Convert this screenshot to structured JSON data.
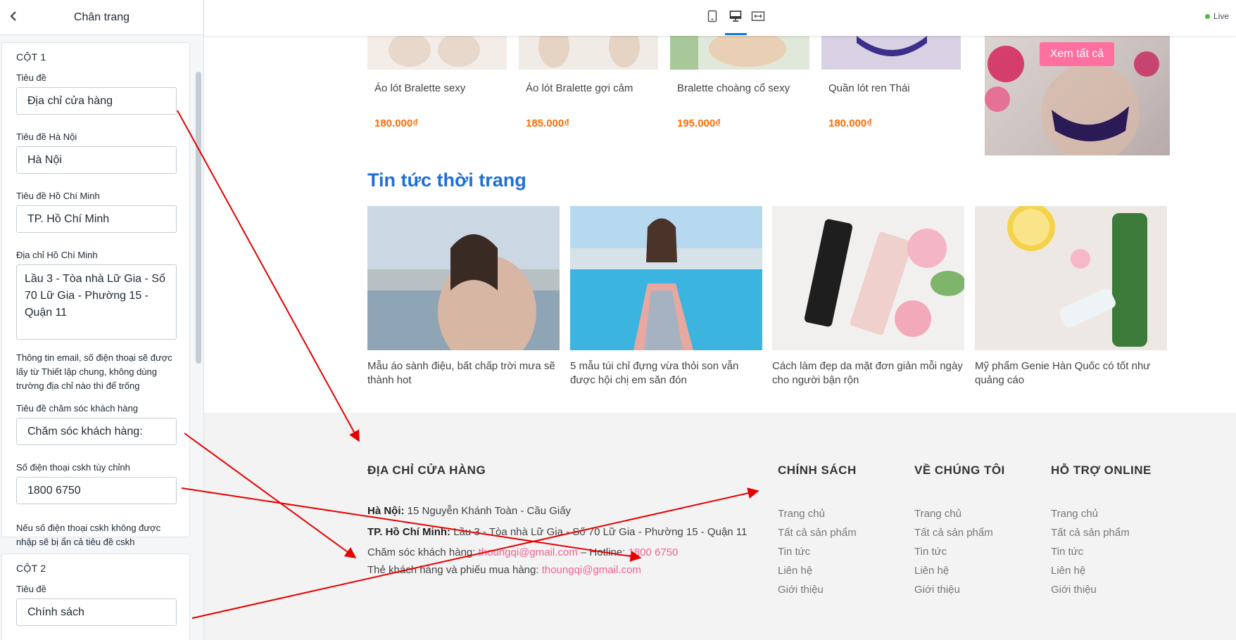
{
  "sidebar": {
    "title": "Chân trang",
    "col1": {
      "title": "CỘT 1",
      "label_title": "Tiêu đề",
      "value_title": "Địa chỉ cửa hàng",
      "label_hanoi": "Tiêu đề Hà Nội",
      "value_hanoi": "Hà Nội",
      "label_hcm": "Tiêu đề Hồ Chí Minh",
      "value_hcm": "TP. Hồ Chí Minh",
      "label_hcm_address": "Địa chỉ Hồ Chí Minh",
      "value_hcm_address": "Lầu 3 - Tòa nhà Lữ Gia - Số 70 Lữ Gia - Phường 15 - Quận 11",
      "help_email": "Thông tin email, số điện thoại sẽ được lấy từ Thiết lập chung, không dùng trường địa chỉ nào thì để trống",
      "label_care": "Tiêu đề chăm sóc khách hàng",
      "value_care": "Chăm sóc khách hàng:",
      "label_phone": "Số điện thoại cskh tùy chỉnh",
      "value_phone": "1800 6750",
      "help_phone": "Nếu số điện thoại cskh không được nhập sẽ bị ẩn cả tiêu đề cskh"
    },
    "col2": {
      "title": "CỘT 2",
      "label_title": "Tiêu đề",
      "value_title": "Chính sách"
    }
  },
  "topbar": {
    "live": "Live"
  },
  "products": [
    {
      "name": "Áo lót Bralette sexy",
      "price": "180.000₫"
    },
    {
      "name": "Áo lót Bralette gợi cảm",
      "price": "185.000₫"
    },
    {
      "name": "Bralette choàng cổ sexy",
      "price": "195.000₫"
    },
    {
      "name": "Quần lót ren Thái",
      "price": "180.000₫"
    }
  ],
  "banner": {
    "button": "Xem tất cả"
  },
  "news": {
    "title": "Tin tức thời trang",
    "items": [
      {
        "text": "Mẫu áo sành điệu, bất chấp trời mưa sẽ thành hot"
      },
      {
        "text": "5 mẫu túi chỉ đựng vừa thỏi son vẫn được hội chị em săn đón"
      },
      {
        "text": "Cách làm đẹp da mặt đơn giản mỗi ngày cho người bận rộn"
      },
      {
        "text": "Mỹ phẩm Genie Hàn Quốc có tốt như quảng cáo"
      }
    ]
  },
  "footer": {
    "address_title": "ĐỊA CHỈ CỬA HÀNG",
    "hanoi_label": "Hà Nội:",
    "hanoi_value": "15 Nguyễn Khánh Toàn - Cầu Giấy",
    "hcm_label": "TP. Hồ Chí Minh:",
    "hcm_value": "Lầu 3 - Tòa nhà Lữ Gia - Số 70 Lữ Gia - Phường 15 - Quận 11",
    "care_label": "Chăm sóc khách hàng:",
    "care_email": "thoungqi@gmail.com",
    "hotline_label": "– Hotline:",
    "hotline_value": "1800 6750",
    "member_label": "Thẻ khách hàng và phiếu mua hàng:",
    "member_email": "thoungqi@gmail.com",
    "columns": [
      {
        "title": "CHÍNH SÁCH",
        "links": [
          "Trang chủ",
          "Tất cả sản phẩm",
          "Tin tức",
          "Liên hệ",
          "Giới thiệu"
        ]
      },
      {
        "title": "VỀ CHÚNG TÔI",
        "links": [
          "Trang chủ",
          "Tất cả sản phẩm",
          "Tin tức",
          "Liên hệ",
          "Giới thiệu"
        ]
      },
      {
        "title": "HỖ TRỢ ONLINE",
        "links": [
          "Trang chủ",
          "Tất cả sản phẩm",
          "Tin tức",
          "Liên hệ",
          "Giới thiệu"
        ]
      }
    ]
  },
  "colors": {
    "accent_blue": "#1e6fd9",
    "price_orange": "#ff6a00",
    "pink": "#f06292",
    "arrow_red": "#e60000"
  },
  "icons": [
    "back-chevron-icon",
    "mobile-device-icon",
    "desktop-device-icon",
    "fullwidth-device-icon"
  ]
}
